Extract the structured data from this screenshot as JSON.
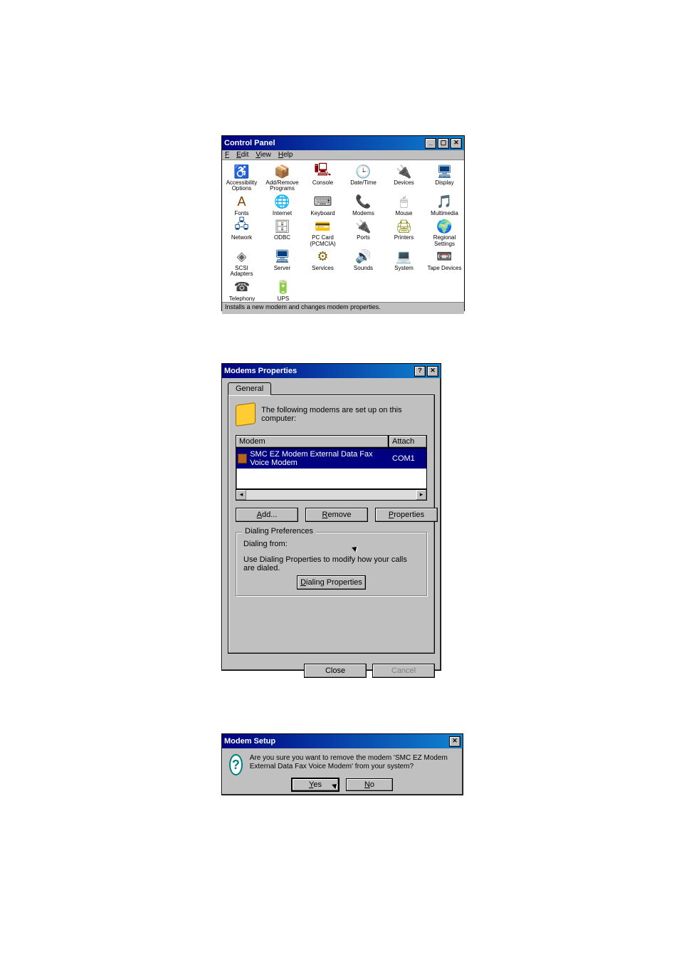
{
  "controlPanel": {
    "title": "Control Panel",
    "menu": {
      "file": "File",
      "edit": "Edit",
      "view": "View",
      "help": "Help"
    },
    "items": [
      {
        "label": "Accessibility Options",
        "glyph": "♿",
        "color": "#004080"
      },
      {
        "label": "Add/Remove Programs",
        "glyph": "📦",
        "color": "#008080"
      },
      {
        "label": "Console",
        "glyph": "🖳",
        "color": "#800000"
      },
      {
        "label": "Date/Time",
        "glyph": "🕒",
        "color": "#0040a0"
      },
      {
        "label": "Devices",
        "glyph": "🔌",
        "color": "#a07000"
      },
      {
        "label": "Display",
        "glyph": "🖥",
        "color": "#004080"
      },
      {
        "label": "Fonts",
        "glyph": "A",
        "color": "#804000"
      },
      {
        "label": "Internet",
        "glyph": "🌐",
        "color": "#006000"
      },
      {
        "label": "Keyboard",
        "glyph": "⌨",
        "color": "#404040"
      },
      {
        "label": "Modems",
        "glyph": "📞",
        "color": "#c08000"
      },
      {
        "label": "Mouse",
        "glyph": "🖱",
        "color": "#808080"
      },
      {
        "label": "Multimedia",
        "glyph": "🎵",
        "color": "#006060"
      },
      {
        "label": "Network",
        "glyph": "🖧",
        "color": "#004080"
      },
      {
        "label": "ODBC",
        "glyph": "🗄",
        "color": "#606060"
      },
      {
        "label": "PC Card (PCMCIA)",
        "glyph": "💳",
        "color": "#806000"
      },
      {
        "label": "Ports",
        "glyph": "🔌",
        "color": "#606060"
      },
      {
        "label": "Printers",
        "glyph": "🖨",
        "color": "#808000"
      },
      {
        "label": "Regional Settings",
        "glyph": "🌍",
        "color": "#006000"
      },
      {
        "label": "SCSI Adapters",
        "glyph": "◈",
        "color": "#606060"
      },
      {
        "label": "Server",
        "glyph": "🖥",
        "color": "#004080"
      },
      {
        "label": "Services",
        "glyph": "⚙",
        "color": "#806000"
      },
      {
        "label": "Sounds",
        "glyph": "🔊",
        "color": "#806000"
      },
      {
        "label": "System",
        "glyph": "💻",
        "color": "#404040"
      },
      {
        "label": "Tape Devices",
        "glyph": "📼",
        "color": "#404040"
      },
      {
        "label": "Telephony",
        "glyph": "☎",
        "color": "#404040"
      },
      {
        "label": "UPS",
        "glyph": "🔋",
        "color": "#806000"
      }
    ],
    "status": "Installs a new modem and changes modem properties."
  },
  "modemsProps": {
    "title": "Modems Properties",
    "tab": "General",
    "intro": "The following modems are set up on this computer:",
    "columns": {
      "modem": "Modem",
      "attached": "Attach"
    },
    "row": {
      "name": "SMC EZ Modem External Data Fax Voice Modem",
      "port": "COM1"
    },
    "buttons": {
      "add": "Add...",
      "remove": "Remove",
      "properties": "Properties"
    },
    "group": {
      "legend": "Dialing Preferences",
      "from": "Dialing from:",
      "help": "Use Dialing Properties to modify how your calls are dialed.",
      "btn": "Dialing Properties"
    },
    "footer": {
      "close": "Close",
      "cancel": "Cancel"
    }
  },
  "modemSetup": {
    "title": "Modem Setup",
    "msg": "Are you sure you want to remove the modem 'SMC EZ Modem External Data Fax Voice Modem' from your system?",
    "yes": "Yes",
    "no": "No"
  }
}
